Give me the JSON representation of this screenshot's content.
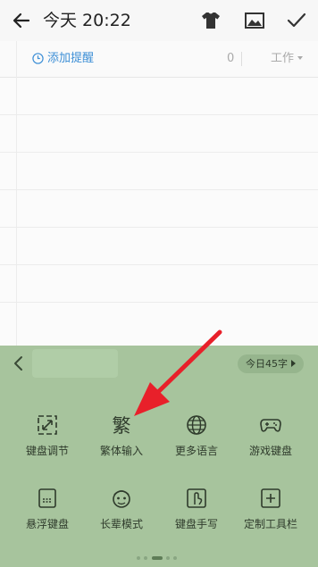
{
  "header": {
    "title": "今天 20:22",
    "icons": [
      "back-arrow-icon",
      "tshirt-icon",
      "image-icon",
      "checkmark-icon"
    ]
  },
  "reminder": {
    "add_label": "添加提醒",
    "count": "0",
    "category": "工作",
    "icon": "clock-icon"
  },
  "keyboard": {
    "word_count_label": "今日45字",
    "colors": {
      "background": "#a7c49d",
      "accent_arrow": "#e8202a"
    },
    "items": [
      {
        "label": "键盘调节",
        "icon": "keyboard-adjust-icon"
      },
      {
        "label": "繁体输入",
        "icon": "traditional-chinese-icon",
        "glyph": "繁"
      },
      {
        "label": "更多语言",
        "icon": "globe-icon"
      },
      {
        "label": "游戏键盘",
        "icon": "gamepad-icon"
      },
      {
        "label": "悬浮键盘",
        "icon": "floating-keyboard-icon"
      },
      {
        "label": "长辈模式",
        "icon": "elder-face-icon"
      },
      {
        "label": "键盘手写",
        "icon": "handwriting-icon"
      },
      {
        "label": "定制工具栏",
        "icon": "custom-toolbar-icon"
      }
    ],
    "page_index": 2,
    "page_count": 4
  }
}
